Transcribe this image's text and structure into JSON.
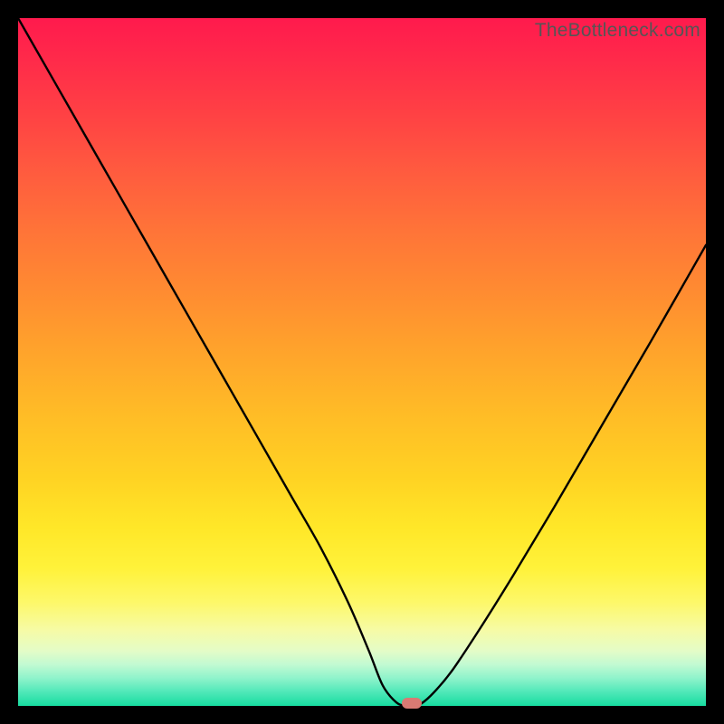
{
  "watermark": "TheBottleneck.com",
  "colors": {
    "frame": "#000000",
    "curve": "#000000",
    "marker": "#d97a73"
  },
  "chart_data": {
    "type": "line",
    "title": "",
    "xlabel": "",
    "ylabel": "",
    "xlim": [
      0,
      100
    ],
    "ylim": [
      0,
      100
    ],
    "grid": false,
    "legend": false,
    "series": [
      {
        "name": "bottleneck-curve",
        "x": [
          0,
          4,
          8,
          12,
          16,
          20,
          24,
          28,
          32,
          36,
          40,
          44,
          48,
          51,
          53,
          55,
          56.5,
          58,
          60,
          63,
          67,
          72,
          78,
          85,
          92,
          100
        ],
        "y": [
          100,
          93,
          86,
          79,
          72,
          65,
          58,
          51,
          44,
          37,
          30,
          23,
          15,
          8,
          3,
          0.5,
          0,
          0,
          1.5,
          5,
          11,
          19,
          29,
          41,
          53,
          67
        ]
      }
    ],
    "marker": {
      "x": 57.2,
      "y": 0
    },
    "background_gradient": {
      "top": "#ff1a4d",
      "mid": "#ffd323",
      "bottom": "#17dca0"
    }
  }
}
